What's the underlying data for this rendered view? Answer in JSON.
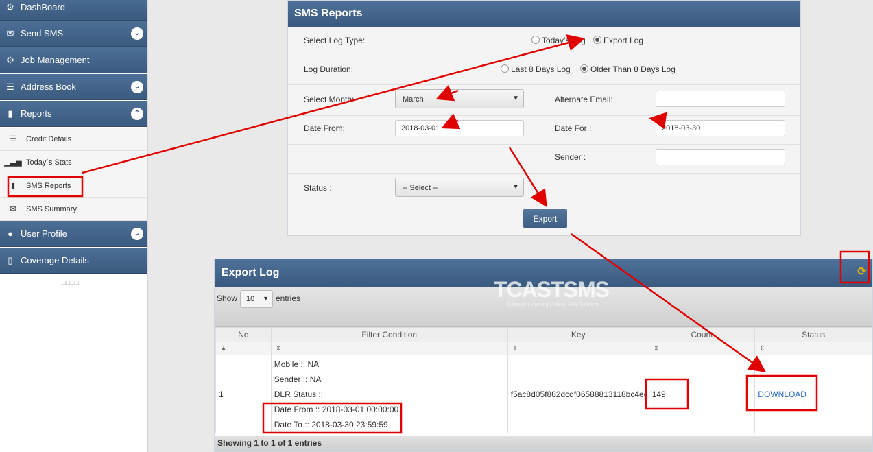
{
  "sidebar": {
    "items": [
      {
        "label": "DashBoard",
        "icon": "gear-icon"
      },
      {
        "label": "Send SMS",
        "icon": "envelope-icon"
      },
      {
        "label": "Job Management",
        "icon": "gear-icon"
      },
      {
        "label": "Address Book",
        "icon": "list-icon"
      },
      {
        "label": "Reports",
        "icon": "document-icon"
      },
      {
        "label": "User Profile",
        "icon": "user-icon"
      },
      {
        "label": "Coverage Details",
        "icon": "book-icon"
      }
    ],
    "reports_sub": [
      {
        "label": "Credit Details",
        "icon": "list-icon"
      },
      {
        "label": "Today`s Stats",
        "icon": "bar-chart-icon"
      },
      {
        "label": "SMS Reports",
        "icon": "document-icon"
      },
      {
        "label": "SMS Summary",
        "icon": "envelope-icon"
      }
    ]
  },
  "reports": {
    "title": "SMS Reports",
    "log_type_label": "Select Log Type:",
    "log_type_options": [
      "Today's Log",
      "Export Log"
    ],
    "log_type_selected": "Export Log",
    "duration_label": "Log Duration:",
    "duration_options": [
      "Last 8 Days Log",
      "Older Than 8 Days Log"
    ],
    "duration_selected": "Older Than 8 Days Log",
    "month_label": "Select Month:",
    "month_value": "March",
    "alt_email_label": "Alternate Email:",
    "alt_email_value": "",
    "date_from_label": "Date From:",
    "date_from_value": "2018-03-01",
    "date_for_label": "Date For :",
    "date_for_value": "2018-03-30",
    "sender_label": "Sender :",
    "sender_value": "",
    "status_label": "Status :",
    "status_value": "-- Select --",
    "export_button": "Export"
  },
  "export_log": {
    "title": "Export Log",
    "logo_text": "TCASTSMS",
    "logo_tagline": "Gateway | Masking | Voice | M2M Solutions",
    "show_label": "Show",
    "entries_value": "10",
    "entries_label": "entries",
    "columns": [
      "No",
      "Filter Condition",
      "Key",
      "Count",
      "Status"
    ],
    "rows": [
      {
        "no": "1",
        "filters": [
          "Mobile :: NA",
          "Sender :: NA",
          "DLR Status ::",
          "Date From :: 2018-03-01 00:00:00",
          "Date To :: 2018-03-30 23:59:59"
        ],
        "key": "f5ac8d05f882dcdf06588813118bc4ec",
        "count": "149",
        "status": "DOWNLOAD"
      }
    ],
    "footer": "Showing 1 to 1 of 1 entries"
  },
  "colors": {
    "header_blue": "#3b5b80",
    "annotation_red": "#e00000",
    "link_blue": "#2a6ebb"
  }
}
